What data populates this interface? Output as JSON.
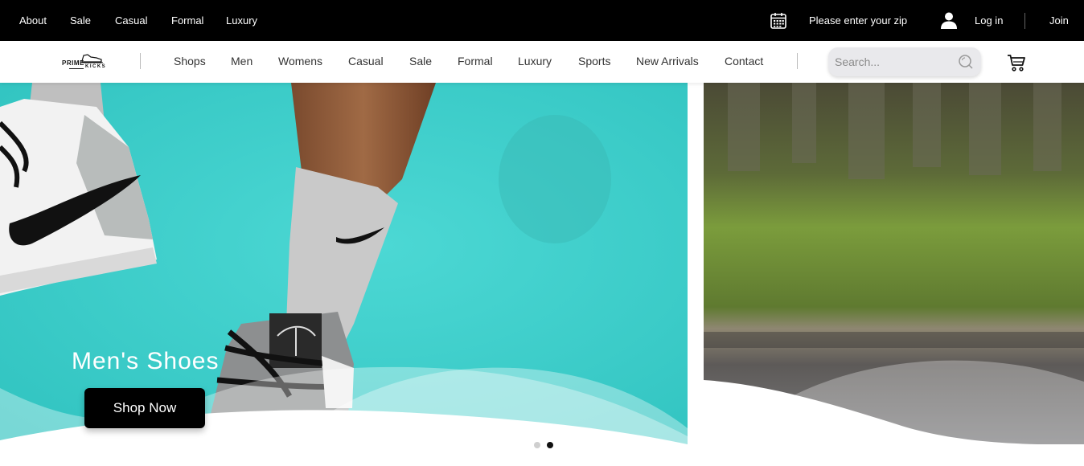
{
  "topbar": {
    "links": [
      "About",
      "Sale",
      "Casual",
      "Formal",
      "Luxury"
    ],
    "zip_prompt": "Please enter your zip",
    "login_label": "Log in",
    "join_label": "Join"
  },
  "logo": {
    "line1": "PRIME",
    "line2": "KICKS"
  },
  "nav": {
    "links": [
      "Shops",
      "Men",
      "Womens",
      "Casual",
      "Sale",
      "Formal",
      "Luxury",
      "Sports",
      "New Arrivals",
      "Contact"
    ]
  },
  "search": {
    "placeholder": "Search..."
  },
  "hero": {
    "title": "Men's Shoes",
    "button_label": "Shop Now",
    "active_slide": 2,
    "slide_count": 2
  },
  "colors": {
    "topbar_bg": "#000000",
    "hero_teal": "#3fd0cc",
    "button_bg": "#000000"
  }
}
